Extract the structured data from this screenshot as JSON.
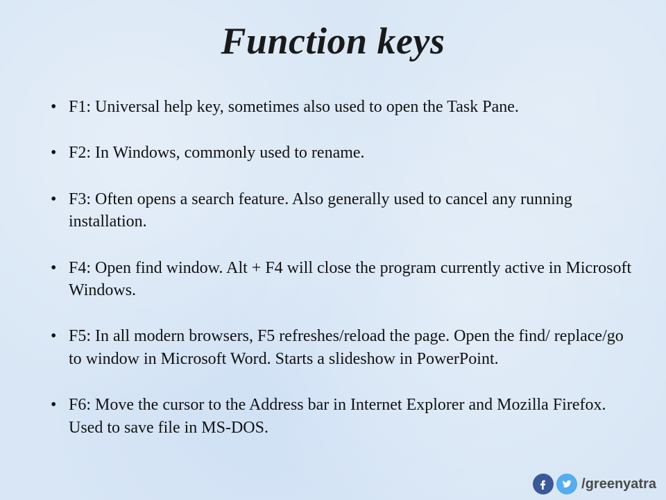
{
  "title": "Function keys",
  "bullets": [
    "F1: Universal help key, sometimes also used to open the Task Pane.",
    "F2: In Windows, commonly used to rename.",
    "F3: Often opens a search feature. Also generally used to cancel any running installation.",
    "F4: Open find window.  Alt + F4 will close the program currently active in Microsoft Windows.",
    "F5: In all modern browsers, F5 refreshes/reload the page. Open the find/ replace/go to window in Microsoft Word. Starts a slideshow in PowerPoint.",
    "F6: Move the cursor to the Address bar in Internet Explorer and Mozilla Firefox. Used to save file in MS-DOS."
  ],
  "social": {
    "handle": "/greenyatra"
  }
}
